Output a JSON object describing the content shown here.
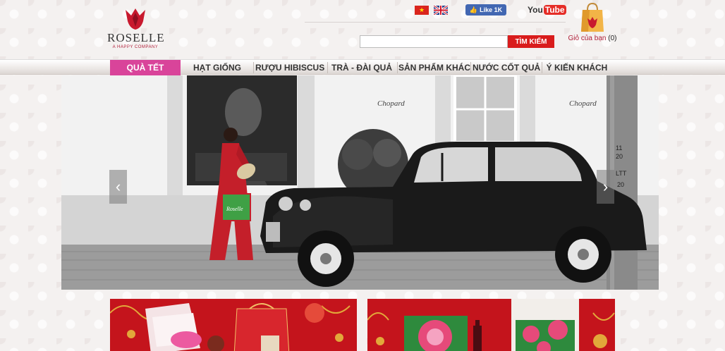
{
  "header": {
    "logo": {
      "brand": "ROSELLE",
      "tagline": "A HAPPY COMPANY"
    },
    "languages": [
      {
        "name": "Vietnamese",
        "icon": "vietnam-flag-icon"
      },
      {
        "name": "English",
        "icon": "uk-flag-icon"
      }
    ],
    "facebook": {
      "label": "Like 1K"
    },
    "youtube": {
      "you": "You",
      "tube": "Tube"
    },
    "search": {
      "placeholder": "",
      "button_label": "TÌM KIẾM"
    },
    "cart": {
      "label": "Giỏ của bạn",
      "count": "(0)"
    }
  },
  "nav": {
    "items": [
      {
        "label": "QUÀ TẾT",
        "active": true
      },
      {
        "label": "HẠT GIỐNG"
      },
      {
        "label": "RƯỢU HIBISCUS"
      },
      {
        "label": "TRÀ - ĐÀI QUẢ"
      },
      {
        "label": "SẢN PHẨM KHÁC"
      },
      {
        "label": "NƯỚC CỐT QUẢ"
      },
      {
        "label": "Ý KIẾN KHÁCH"
      }
    ]
  },
  "banner": {
    "prev_icon": "chevron-left-icon",
    "next_icon": "chevron-right-icon",
    "prev_glyph": "‹",
    "next_glyph": "›",
    "storefront_text": "Chopard",
    "bag_text": "Roselle",
    "pole_numbers": [
      "11",
      "20",
      "LTT",
      "20"
    ]
  },
  "colors": {
    "accent_red": "#d91c1c",
    "nav_active": "#d9449a",
    "brand_red": "#b0203a"
  }
}
